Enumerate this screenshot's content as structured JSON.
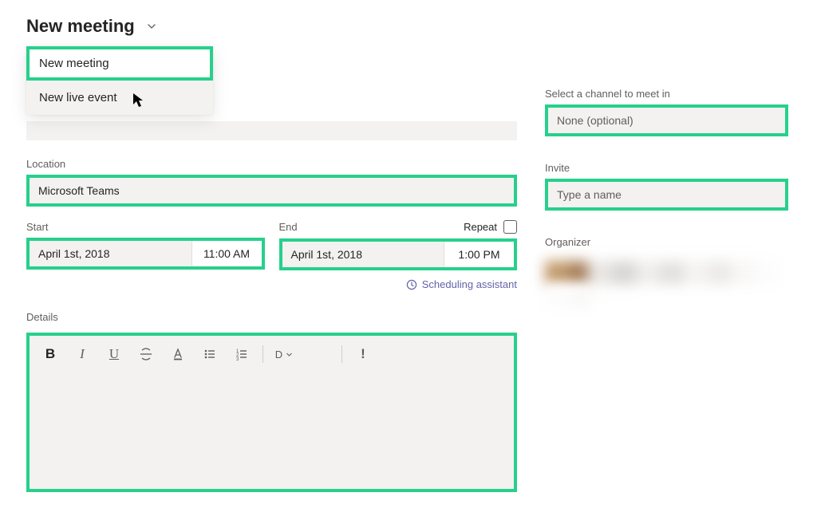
{
  "header": {
    "title": "New meeting"
  },
  "dropdown": {
    "items": [
      {
        "label": "New meeting",
        "selected": true
      },
      {
        "label": "New live event",
        "selected": false
      }
    ]
  },
  "title_input": {
    "value": "",
    "placeholder": ""
  },
  "location": {
    "label": "Location",
    "value": "Microsoft Teams"
  },
  "start": {
    "label": "Start",
    "date": "April 1st, 2018",
    "time": "11:00 AM"
  },
  "end": {
    "label": "End",
    "date": "April 1st, 2018",
    "time": "1:00 PM"
  },
  "repeat_label": "Repeat",
  "scheduling_assistant": "Scheduling assistant",
  "details_label": "Details",
  "toolbar": {
    "bold": "B",
    "italic": "I",
    "underline": "U",
    "fontsize_label": "D",
    "exclaim": "!"
  },
  "channel": {
    "label": "Select a channel to meet in",
    "value": "None (optional)"
  },
  "invite": {
    "label": "Invite",
    "placeholder": "Type a name"
  },
  "organizer_label": "Organizer"
}
